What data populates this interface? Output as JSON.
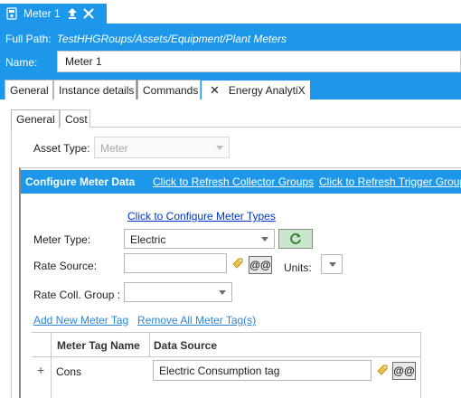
{
  "document_tab": {
    "title": "Meter 1",
    "icon": "meter-icon",
    "pin_icon": "pin-icon",
    "close_icon": "close-icon"
  },
  "header": {
    "full_path_label": "Full Path:",
    "full_path_value": "TestHHGRoups/Assets/Equipment/Plant Meters",
    "name_label": "Name:",
    "name_value": "Meter 1"
  },
  "main_tabs": [
    {
      "label": "General"
    },
    {
      "label": "Instance details"
    },
    {
      "label": "Commands"
    },
    {
      "label": "Energy AnalytiX",
      "close": "✕"
    }
  ],
  "sub_tabs": [
    {
      "label": "General"
    },
    {
      "label": "Cost"
    }
  ],
  "asset_type": {
    "label": "Asset Type:",
    "value": "Meter"
  },
  "configure": {
    "title": "Configure Meter Data",
    "refresh_collector": "Click to Refresh Collector Groups",
    "refresh_trigger": "Click to Refresh Trigger Group",
    "configure_types_link": "Click to Configure Meter Types",
    "meter_type_label": "Meter Type:",
    "meter_type_value": "Electric",
    "rate_source_label": "Rate Source:",
    "rate_source_value": "",
    "at_button": "@@",
    "units_label": "Units:",
    "units_value": "",
    "rate_group_label": "Rate Coll. Group :",
    "rate_group_value": "",
    "add_tag_link": "Add New Meter Tag",
    "remove_tags_link": "Remove All Meter Tag(s)"
  },
  "grid": {
    "columns": [
      "Meter Tag Name",
      "Data Source"
    ],
    "rows": [
      {
        "expand": "+",
        "name": "Cons",
        "data_source": "Electric Consumption tag",
        "at_button": "@@"
      }
    ]
  },
  "colors": {
    "accent": "#1c97ea",
    "link": "#0033cc",
    "refresh_btn": "#c8e6c9"
  }
}
